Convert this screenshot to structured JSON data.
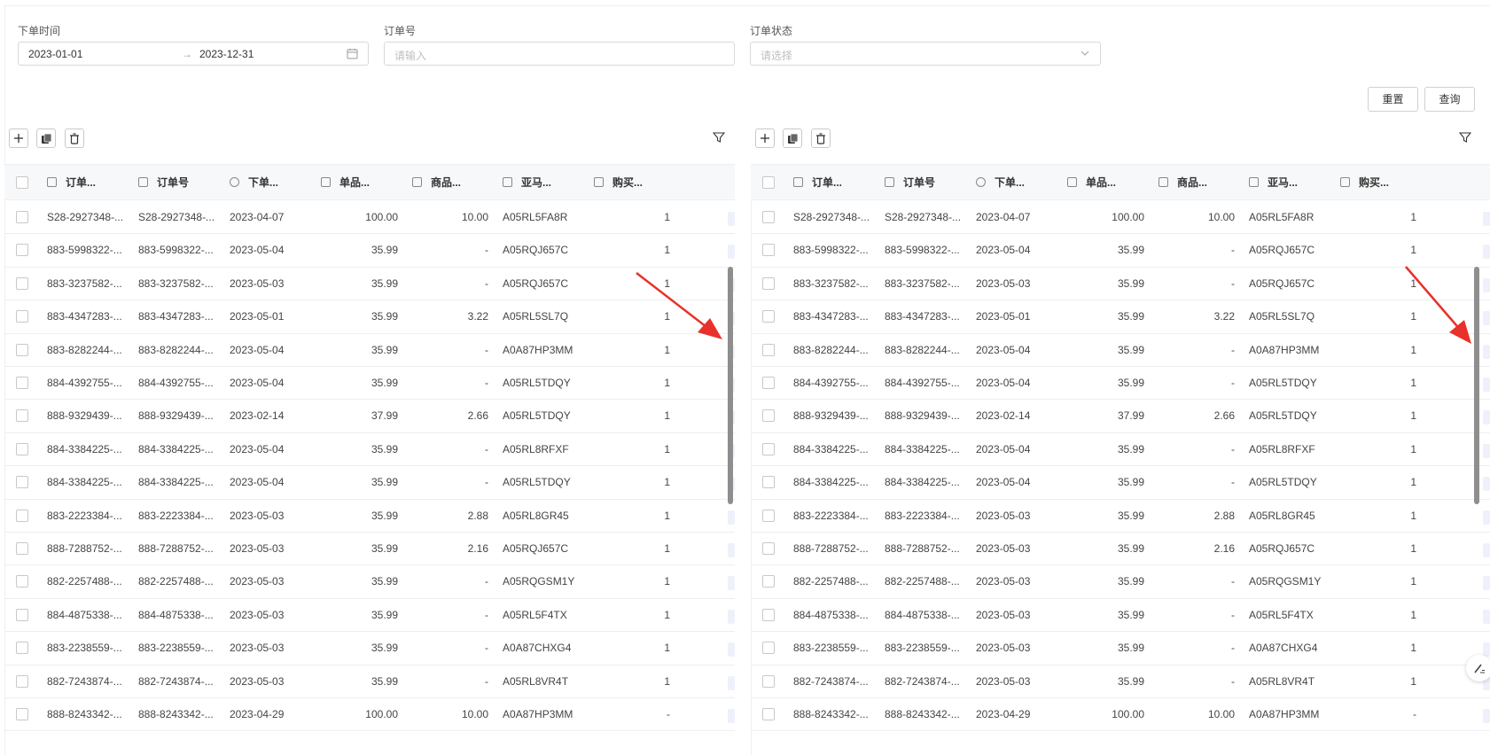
{
  "filters": {
    "order_time_label": "下单时间",
    "start_date": "2023-01-01",
    "end_date": "2023-12-31",
    "order_no_label": "订单号",
    "order_no_placeholder": "请输入",
    "order_status_label": "订单状态",
    "order_status_placeholder": "请选择"
  },
  "buttons": {
    "reset": "重置",
    "query": "查询"
  },
  "table": {
    "columns": [
      "订单...",
      "订单号",
      "下单...",
      "单品...",
      "商品...",
      "亚马...",
      "购买..."
    ],
    "rows": [
      [
        "S28-2927348-...",
        "S28-2927348-...",
        "2023-04-07",
        "100.00",
        "10.00",
        "A05RL5FA8R",
        "1"
      ],
      [
        "883-5998322-...",
        "883-5998322-...",
        "2023-05-04",
        "35.99",
        "-",
        "A05RQJ657C",
        "1"
      ],
      [
        "883-3237582-...",
        "883-3237582-...",
        "2023-05-03",
        "35.99",
        "-",
        "A05RQJ657C",
        "1"
      ],
      [
        "883-4347283-...",
        "883-4347283-...",
        "2023-05-01",
        "35.99",
        "3.22",
        "A05RL5SL7Q",
        "1"
      ],
      [
        "883-8282244-...",
        "883-8282244-...",
        "2023-05-04",
        "35.99",
        "-",
        "A0A87HP3MM",
        "1"
      ],
      [
        "884-4392755-...",
        "884-4392755-...",
        "2023-05-04",
        "35.99",
        "-",
        "A05RL5TDQY",
        "1"
      ],
      [
        "888-9329439-...",
        "888-9329439-...",
        "2023-02-14",
        "37.99",
        "2.66",
        "A05RL5TDQY",
        "1"
      ],
      [
        "884-3384225-...",
        "884-3384225-...",
        "2023-05-04",
        "35.99",
        "-",
        "A05RL8RFXF",
        "1"
      ],
      [
        "884-3384225-...",
        "884-3384225-...",
        "2023-05-04",
        "35.99",
        "-",
        "A05RL5TDQY",
        "1"
      ],
      [
        "883-2223384-...",
        "883-2223384-...",
        "2023-05-03",
        "35.99",
        "2.88",
        "A05RL8GR45",
        "1"
      ],
      [
        "888-7288752-...",
        "888-7288752-...",
        "2023-05-03",
        "35.99",
        "2.16",
        "A05RQJ657C",
        "1"
      ],
      [
        "882-2257488-...",
        "882-2257488-...",
        "2023-05-03",
        "35.99",
        "-",
        "A05RQGSM1Y",
        "1"
      ],
      [
        "884-4875338-...",
        "884-4875338-...",
        "2023-05-03",
        "35.99",
        "-",
        "A05RL5F4TX",
        "1"
      ],
      [
        "883-2238559-...",
        "883-2238559-...",
        "2023-05-03",
        "35.99",
        "-",
        "A0A87CHXG4",
        "1"
      ],
      [
        "882-7243874-...",
        "882-7243874-...",
        "2023-05-03",
        "35.99",
        "-",
        "A05RL8VR4T",
        "1"
      ],
      [
        "888-8243342-...",
        "888-8243342-...",
        "2023-04-29",
        "100.00",
        "10.00",
        "A0A87HP3MM",
        "-"
      ]
    ]
  },
  "colors": {
    "arrow": "#e8312a",
    "border": "#d9d9d9",
    "header_bg": "#f7f8fa"
  },
  "icons": [
    "add-icon",
    "copy-icon",
    "delete-icon",
    "filter-icon",
    "calendar-icon",
    "chevron-down-icon",
    "edit-icon"
  ]
}
